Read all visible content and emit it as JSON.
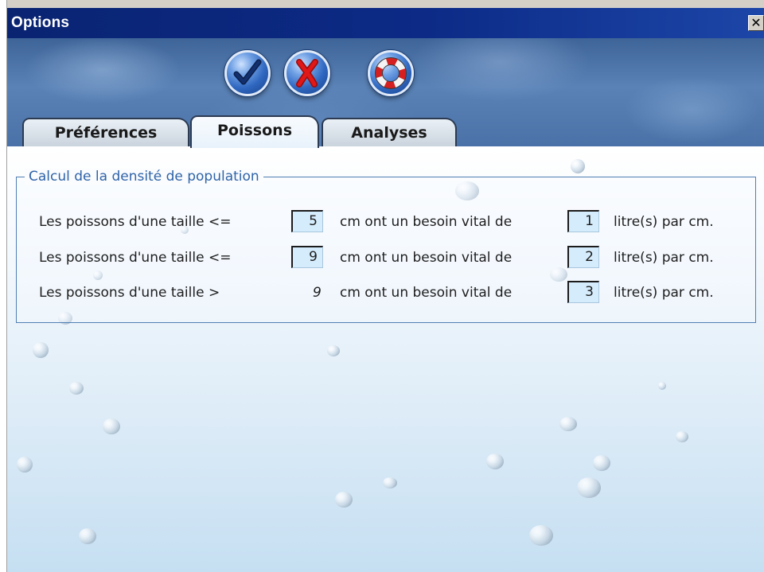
{
  "window": {
    "title": "Options",
    "close_glyph": "✕"
  },
  "toolbar": {
    "ok_icon": "checkmark-icon",
    "cancel_icon": "red-x-icon",
    "help_icon": "lifebuoy-icon"
  },
  "tabs": [
    {
      "label": "Préférences",
      "active": false
    },
    {
      "label": "Poissons",
      "active": true
    },
    {
      "label": "Analyses",
      "active": false
    }
  ],
  "group": {
    "legend": "Calcul de la densité de population",
    "rows": [
      {
        "prefix": "Les poissons d'une taille <=",
        "size": "5",
        "middle": "cm ont un besoin vital de",
        "litres": "1",
        "suffix": "litre(s) par cm."
      },
      {
        "prefix": "Les poissons d'une taille <=",
        "size": "9",
        "middle": "cm ont un besoin vital de",
        "litres": "2",
        "suffix": "litre(s) par cm."
      },
      {
        "prefix": "Les poissons d'une taille >",
        "size": "9",
        "middle": "cm ont un besoin vital de",
        "litres": "3",
        "suffix": "litre(s) par cm."
      }
    ]
  },
  "colors": {
    "titlebar": "#0c2a86",
    "legend_text": "#2f63a8",
    "input_bg": "#d5ecfc",
    "cancel_red": "#e01818"
  }
}
